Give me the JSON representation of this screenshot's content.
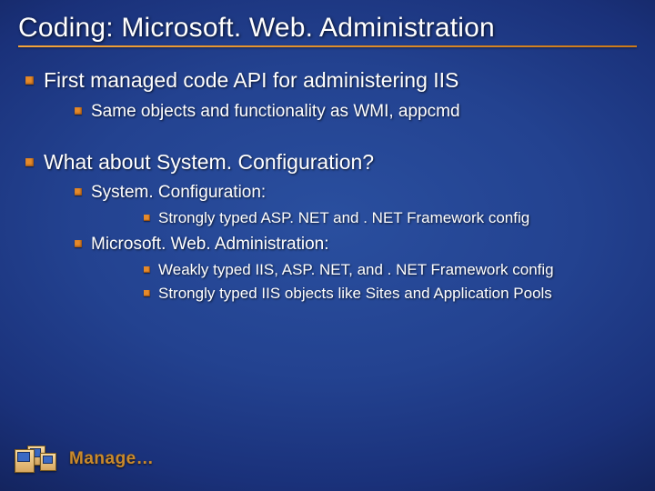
{
  "title": "Coding: Microsoft. Web. Administration",
  "bullets": {
    "b1": "First managed code API for administering IIS",
    "b1_1": "Same objects and functionality as WMI, appcmd",
    "b2": "What about System. Configuration?",
    "b2_1": "System. Configuration:",
    "b2_1_1": "Strongly typed ASP. NET and . NET Framework config",
    "b2_2": "Microsoft. Web. Administration:",
    "b2_2_1": "Weakly typed IIS, ASP. NET, and . NET Framework config",
    "b2_2_2": "Strongly typed IIS objects like Sites and Application Pools"
  },
  "footer": {
    "label": "Manage…"
  }
}
